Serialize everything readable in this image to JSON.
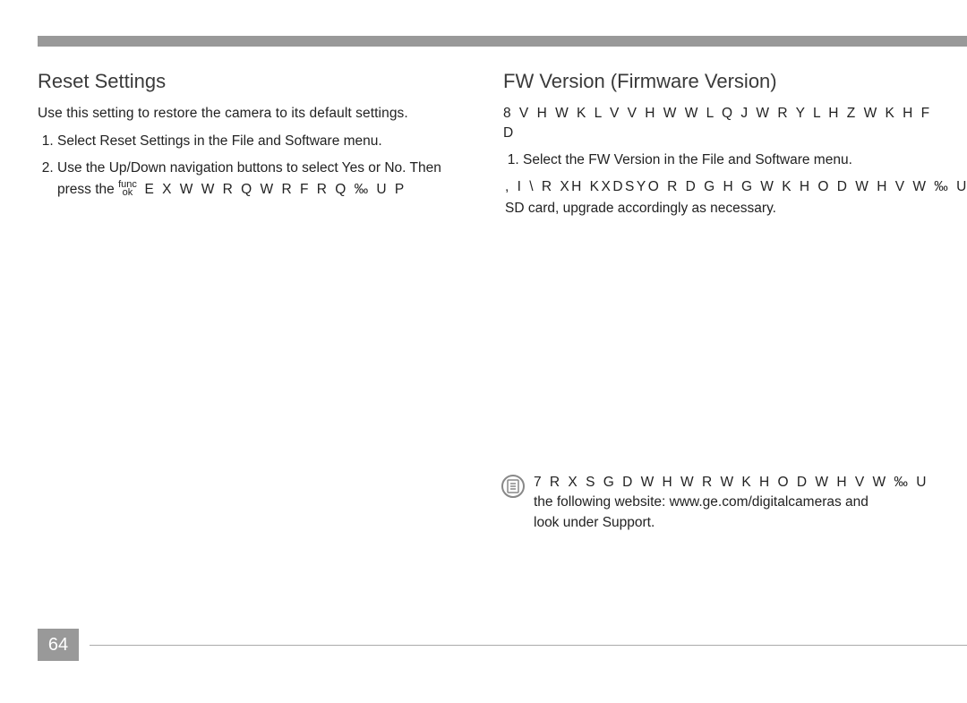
{
  "page_number": "64",
  "left": {
    "heading": "Reset Settings",
    "intro": "Use this setting to restore the camera to its default settings.",
    "steps": [
      "Select Reset Settings in the File and Software menu.",
      "Use the Up/Down navigation buttons to select Yes or No. Then press the"
    ],
    "func_label_top": "func",
    "func_label_bottom": "ok",
    "step2_tail": "E X W W R Q  W R  F R Q ‰ U P"
  },
  "right": {
    "heading": "FW Version (Firmware Version)",
    "intro_garbled": "8 V H  W K L V  V H W W L Q J  W R  Y L H Z  W K H  F D",
    "steps": [
      "Select the FW Version in the File and Software menu."
    ],
    "post_garbled": ", I  \\ R XH KXDSYO R D G H G  W K H  O D W H V W  ‰ U",
    "post_text": "SD card, upgrade accordingly as necessary."
  },
  "note": {
    "garbled": "7 R  X S G D W H  W R  W K H  O D W H V W  ‰ U",
    "line2": "the following website: www.ge.com/digitalcameras and",
    "line3": "look under Support."
  }
}
